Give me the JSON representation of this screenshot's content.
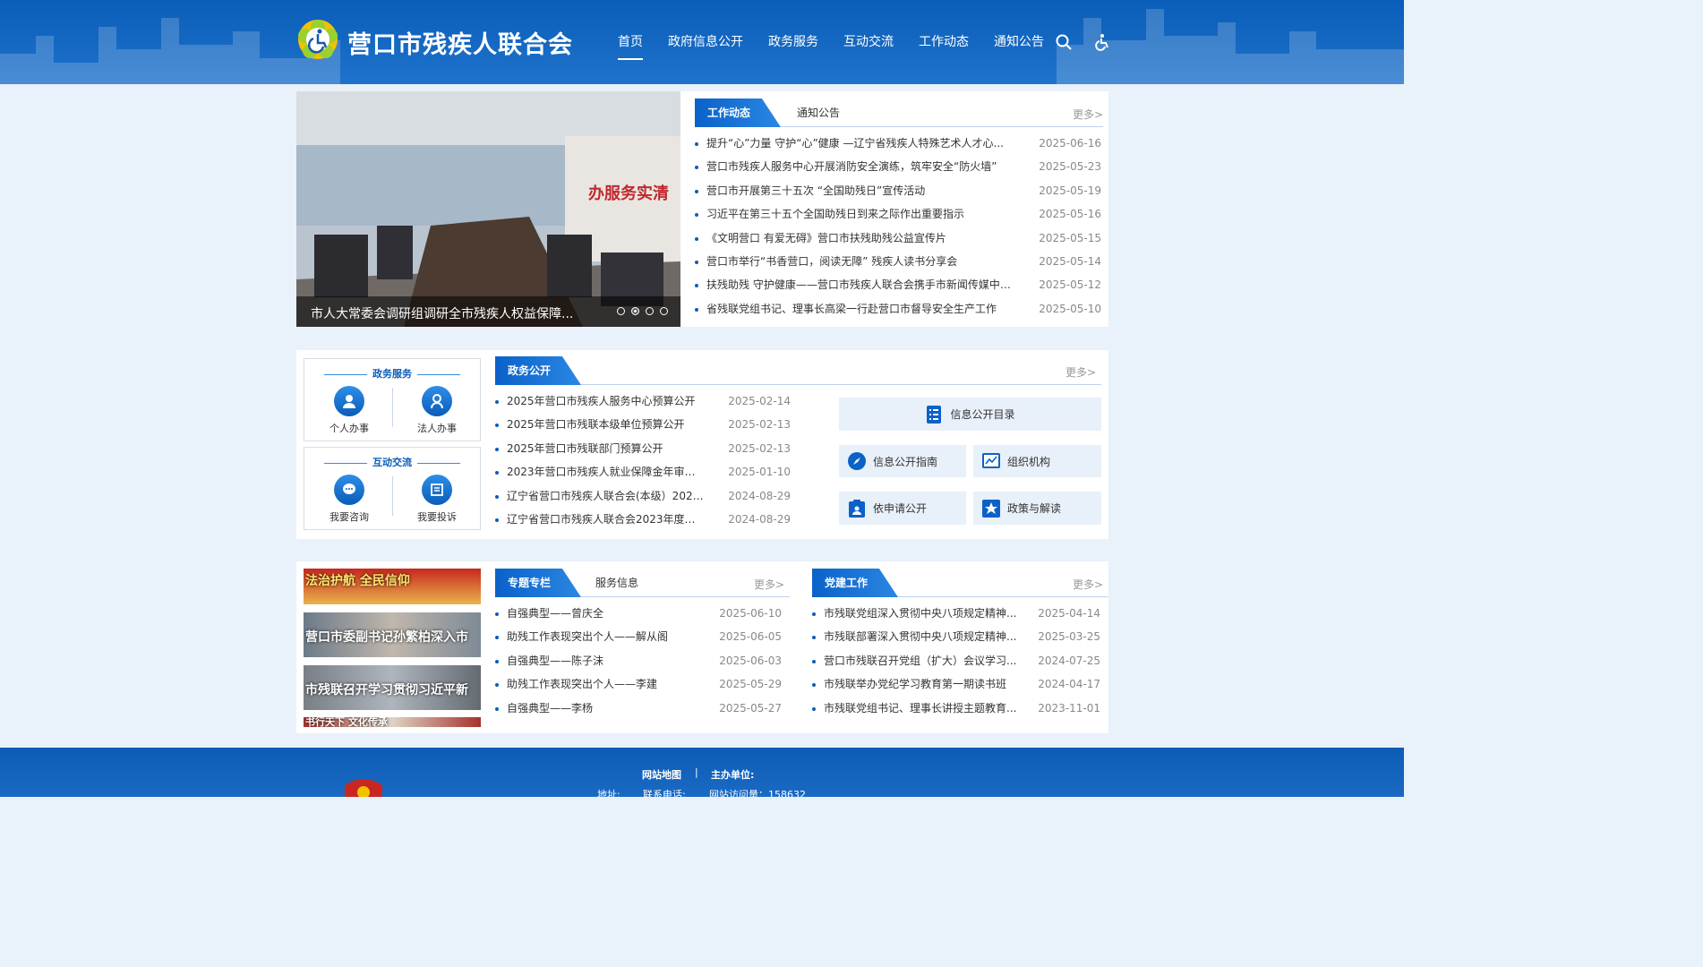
{
  "header": {
    "site_title": "营口市残疾人联合会",
    "nav": [
      "首页",
      "政府信息公开",
      "政务服务",
      "互动交流",
      "工作动态",
      "通知公告"
    ],
    "active_nav": "首页",
    "search_icon": "search-icon",
    "accessibility_icon": "accessibility-icon",
    "logo_icon": "disabled-federation-logo"
  },
  "slider": {
    "caption": "市人大常委会调研组调研全市残疾人权益保障...",
    "slide_count": 4,
    "active_slide": 2,
    "photo_banner_text": "办服务实清"
  },
  "news_panel": {
    "tab_active": "工作动态",
    "tab_other": "通知公告",
    "more": "更多>",
    "items": [
      {
        "title": "提升“心”力量 守护“心”健康 —辽宁省残疾人特殊艺术人才心...",
        "date": "2025-06-16"
      },
      {
        "title": "营口市残疾人服务中心开展消防安全演练，筑牢安全“防火墙”",
        "date": "2025-05-23"
      },
      {
        "title": "营口市开展第三十五次 “全国助残日”宣传活动",
        "date": "2025-05-19"
      },
      {
        "title": "习近平在第三十五个全国助残日到来之际作出重要指示",
        "date": "2025-05-16"
      },
      {
        "title": "《文明营口 有爱无碍》营口市扶残助残公益宣传片",
        "date": "2025-05-15"
      },
      {
        "title": "营口市举行“书香营口，阅读无障” 残疾人读书分享会",
        "date": "2025-05-14"
      },
      {
        "title": "扶残助残 守护健康——营口市残疾人联合会携手市新闻传媒中心...",
        "date": "2025-05-12"
      },
      {
        "title": "省残联党组书记、理事长高梁一行赴营口市督导安全生产工作",
        "date": "2025-05-10"
      }
    ]
  },
  "services": {
    "gov_service_title": "政务服务",
    "personal": "个人办事",
    "corporate": "法人办事",
    "interaction_title": "互动交流",
    "consult": "我要咨询",
    "complain": "我要投诉"
  },
  "gov_open": {
    "tab": "政务公开",
    "more": "更多>",
    "items": [
      {
        "title": "2025年营口市残疾人服务中心预算公开",
        "date": "2025-02-14"
      },
      {
        "title": "2025年营口市残联本级单位预算公开",
        "date": "2025-02-13"
      },
      {
        "title": "2025年营口市残联部门预算公开",
        "date": "2025-02-13"
      },
      {
        "title": "2023年营口市残疾人就业保障金年审明...",
        "date": "2025-01-10"
      },
      {
        "title": "辽宁省营口市残疾人联合会(本级）2023...",
        "date": "2024-08-29"
      },
      {
        "title": "辽宁省营口市残疾人联合会2023年度部...",
        "date": "2024-08-29"
      }
    ],
    "buttons": {
      "catalog": "信息公开目录",
      "guide": "信息公开指南",
      "org": "组织机构",
      "apply": "依申请公开",
      "policy": "政策与解读"
    }
  },
  "banners": [
    "法治护航 全民信仰",
    "营口市委副书记孙繁柏深入市",
    "市残联召开学习贯彻习近平新",
    "书行天下 文化传承"
  ],
  "special_panel": {
    "tab_active": "专题专栏",
    "tab_other": "服务信息",
    "more": "更多>",
    "items": [
      {
        "title": "自强典型——曾庆全",
        "date": "2025-06-10"
      },
      {
        "title": "助残工作表现突出个人——解从阁",
        "date": "2025-06-05"
      },
      {
        "title": "自强典型——陈子沫",
        "date": "2025-06-03"
      },
      {
        "title": "助残工作表现突出个人——李建",
        "date": "2025-05-29"
      },
      {
        "title": "自强典型——李杨",
        "date": "2025-05-27"
      }
    ]
  },
  "party_panel": {
    "tab_active": "党建工作",
    "more": "更多>",
    "items": [
      {
        "title": "市残联党组深入贯彻中央八项规定精神...",
        "date": "2025-04-14"
      },
      {
        "title": "市残联部署深入贯彻中央八项规定精神...",
        "date": "2025-03-25"
      },
      {
        "title": "营口市残联召开党组（扩大）会议学习...",
        "date": "2024-07-25"
      },
      {
        "title": "市残联举办党纪学习教育第一期读书班",
        "date": "2024-04-17"
      },
      {
        "title": "市残联党组书记、理事长讲授主题教育...",
        "date": "2023-11-01"
      }
    ]
  },
  "footer": {
    "sitemap": "网站地图",
    "sep": "|",
    "sponsor": "主办单位:",
    "address": "地址:",
    "phone": "联系电话:",
    "visits": "网站访问量：158632"
  },
  "colors": {
    "primary": "#0a5db8",
    "accent": "#2b86e3",
    "background": "#e9f1fa"
  }
}
